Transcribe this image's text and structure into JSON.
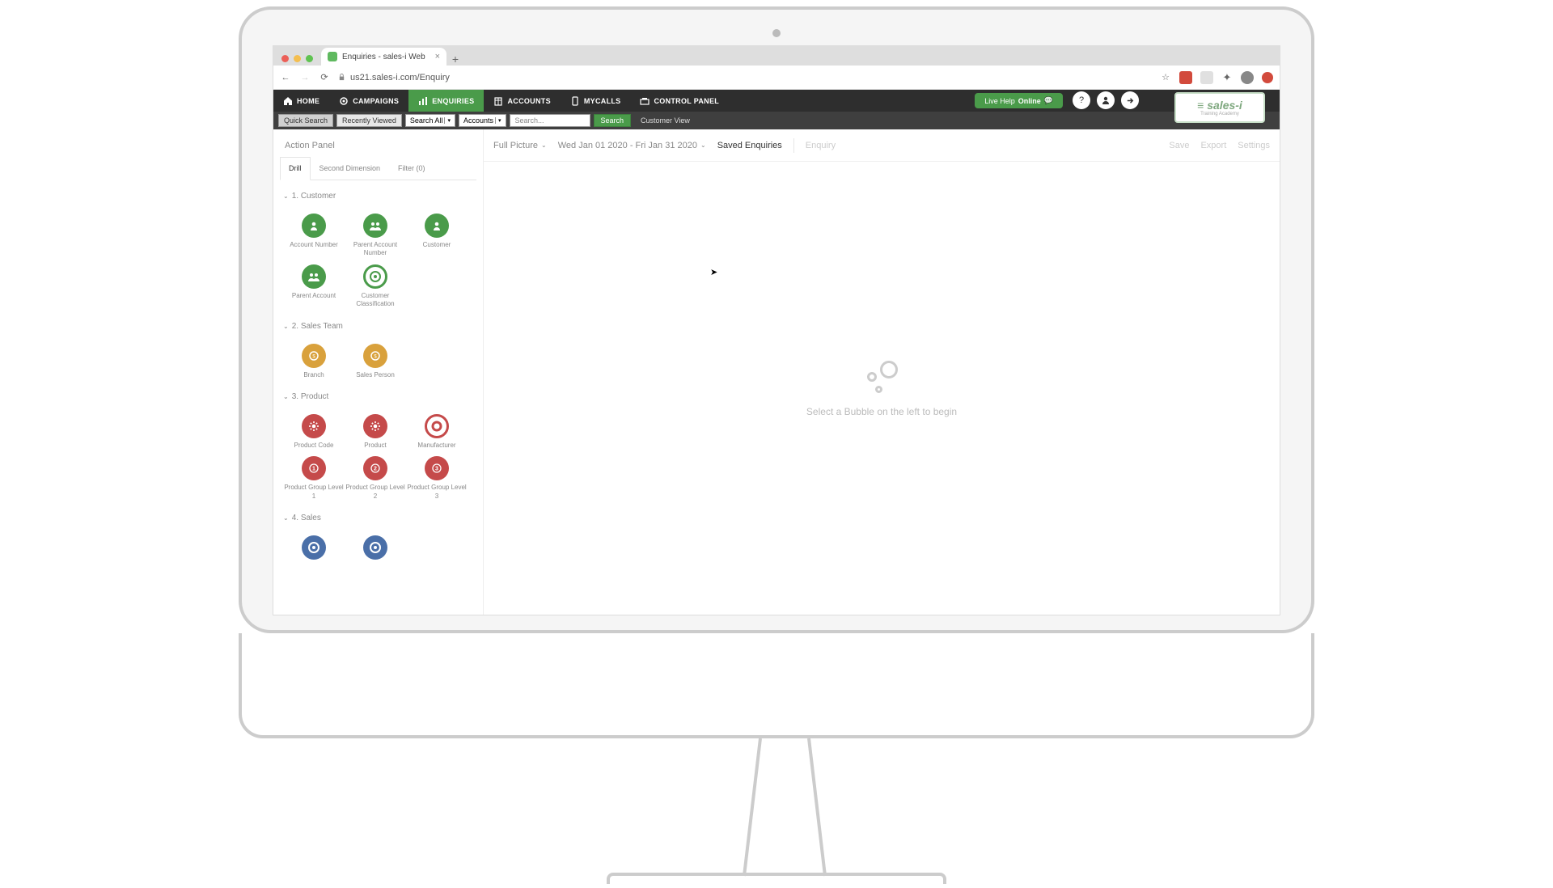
{
  "browser": {
    "tab_title": "Enquiries - sales-i Web",
    "url": "us21.sales-i.com/Enquiry"
  },
  "nav": {
    "home": "HOME",
    "campaigns": "CAMPAIGNS",
    "enquiries": "ENQUIRIES",
    "accounts": "ACCOUNTS",
    "mycalls": "MYCALLS",
    "control_panel": "CONTROL PANEL",
    "live_help": "Live Help",
    "live_status": "Online"
  },
  "searchbar": {
    "quick": "Quick Search",
    "recent": "Recently Viewed",
    "search_all": "Search All",
    "accounts": "Accounts",
    "placeholder": "Search...",
    "search_btn": "Search",
    "customer_view": "Customer View"
  },
  "logo": {
    "main": "≡ sales-i",
    "sub": "Training Academy"
  },
  "action_panel": {
    "title": "Action Panel",
    "tabs": {
      "drill": "Drill",
      "second": "Second Dimension",
      "filter": "Filter (0)"
    },
    "groups": [
      {
        "title": "1. Customer",
        "items": [
          {
            "label": "Account Number",
            "variant": "green",
            "glyph": "person"
          },
          {
            "label": "Parent Account Number",
            "variant": "green",
            "glyph": "people"
          },
          {
            "label": "Customer",
            "variant": "green",
            "glyph": "person"
          },
          {
            "label": "Parent Account",
            "variant": "green",
            "glyph": "people"
          },
          {
            "label": "Customer Classification",
            "variant": "green-ring",
            "glyph": "target"
          }
        ]
      },
      {
        "title": "2. Sales Team",
        "items": [
          {
            "label": "Branch",
            "variant": "orange",
            "glyph": "medal"
          },
          {
            "label": "Sales Person",
            "variant": "orange",
            "glyph": "medal"
          }
        ]
      },
      {
        "title": "3. Product",
        "items": [
          {
            "label": "Product Code",
            "variant": "red",
            "glyph": "gear"
          },
          {
            "label": "Product",
            "variant": "red",
            "glyph": "gear"
          },
          {
            "label": "Manufacturer",
            "variant": "red-ring",
            "glyph": "ring"
          },
          {
            "label": "Product Group Level 1",
            "variant": "red",
            "glyph": "num",
            "num": "1"
          },
          {
            "label": "Product Group Level 2",
            "variant": "red",
            "glyph": "num",
            "num": "2"
          },
          {
            "label": "Product Group Level 3",
            "variant": "red",
            "glyph": "num",
            "num": "3"
          }
        ]
      },
      {
        "title": "4. Sales",
        "items": [
          {
            "label": "",
            "variant": "blue",
            "glyph": "target"
          },
          {
            "label": "",
            "variant": "blue",
            "glyph": "target"
          }
        ]
      }
    ]
  },
  "main": {
    "full_picture": "Full Picture",
    "date_range": "Wed Jan 01 2020 - Fri Jan 31 2020",
    "saved": "Saved Enquiries",
    "enquiry": "Enquiry",
    "save": "Save",
    "export": "Export",
    "settings": "Settings",
    "placeholder": "Select a Bubble on the left to begin"
  }
}
